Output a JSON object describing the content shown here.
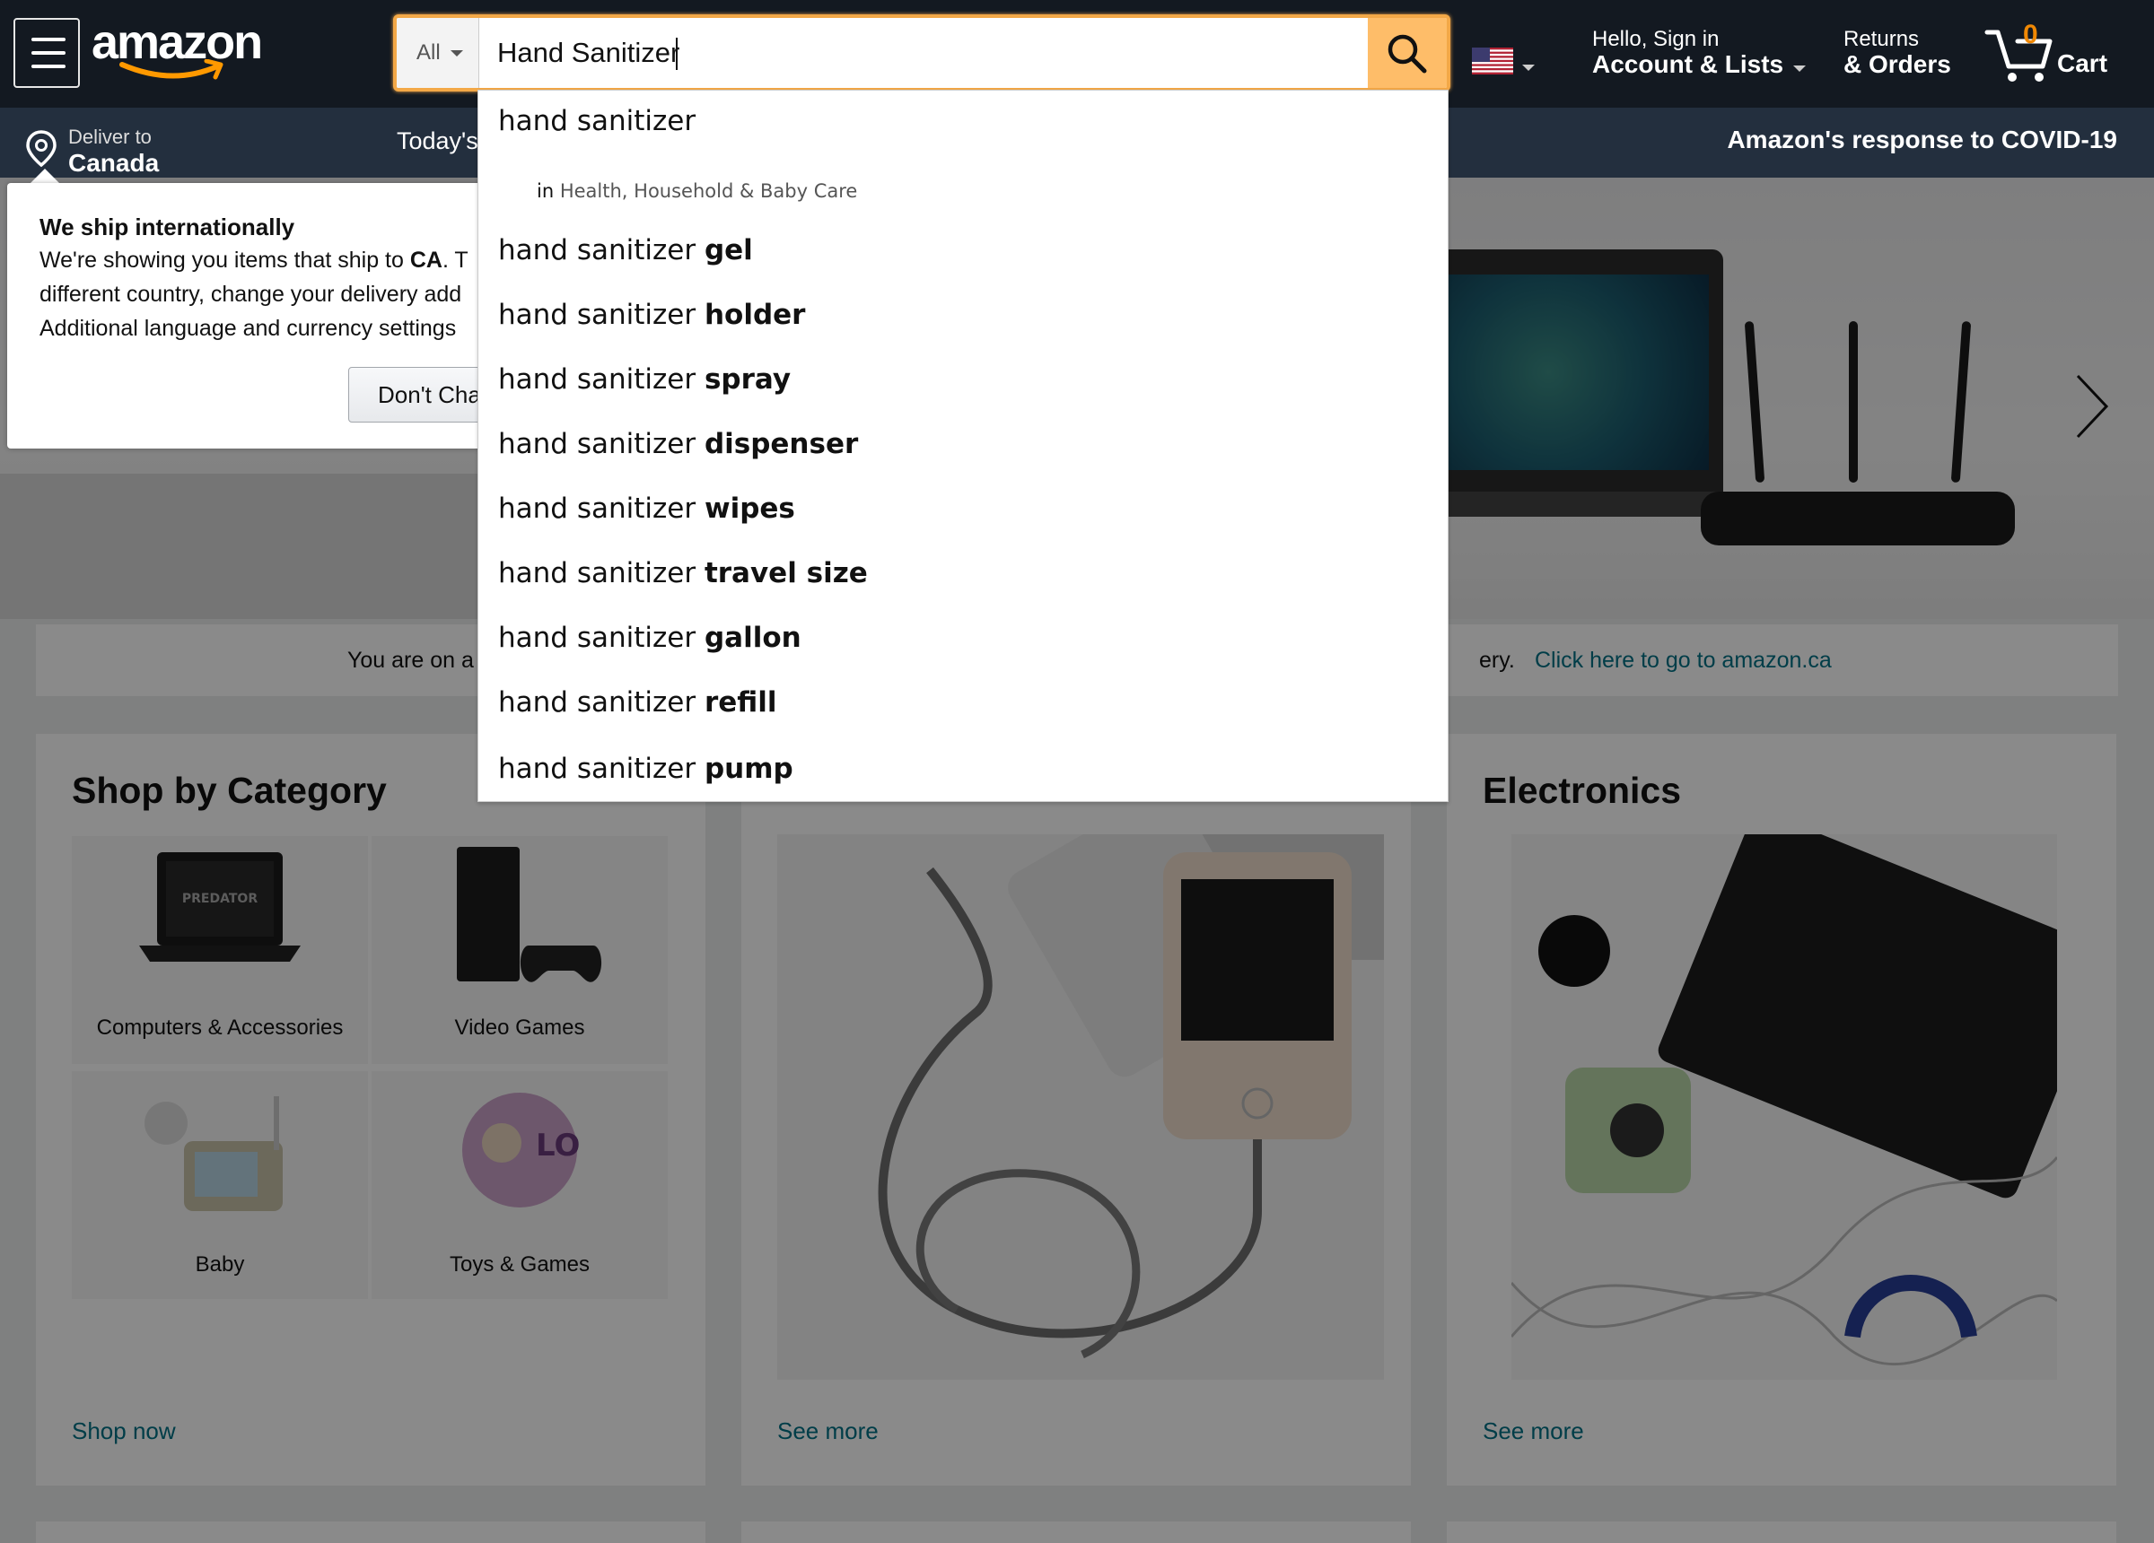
{
  "header": {
    "logo_text": "amazon",
    "search": {
      "category": "All",
      "query": "Hand Sanitizer"
    },
    "greeting": "Hello, Sign in",
    "account_label": "Account & Lists",
    "returns_line1": "Returns",
    "returns_line2": "& Orders",
    "cart_count": "0",
    "cart_label": "Cart"
  },
  "subnav": {
    "deliver_line1": "Deliver to",
    "deliver_line2": "Canada",
    "todays_deals": "Today's",
    "covid_link": "Amazon's response to COVID-19"
  },
  "popover": {
    "title": "We ship internationally",
    "line1_prefix": "We're showing you items that ship to ",
    "line1_bold": "CA",
    "line1_suffix": ". T",
    "line2": "different country, change your delivery add",
    "line3": "Additional language and currency settings",
    "button": "Don't Char"
  },
  "suggestions": {
    "first": "hand sanitizer",
    "department_prefix": "in",
    "department": "Health, Household & Baby Care",
    "items": [
      {
        "prefix": "hand sanitizer ",
        "bold": "gel"
      },
      {
        "prefix": "hand sanitizer ",
        "bold": "holder"
      },
      {
        "prefix": "hand sanitizer ",
        "bold": "spray"
      },
      {
        "prefix": "hand sanitizer ",
        "bold": "dispenser"
      },
      {
        "prefix": "hand sanitizer ",
        "bold": "wipes"
      },
      {
        "prefix": "hand sanitizer ",
        "bold": "travel size"
      },
      {
        "prefix": "hand sanitizer ",
        "bold": "gallon"
      },
      {
        "prefix": "hand sanitizer ",
        "bold": "refill"
      },
      {
        "prefix": "hand sanitizer ",
        "bold": "pump"
      }
    ]
  },
  "notice": {
    "text_start": "You are on a",
    "text_end": "ery.",
    "link": "Click here to go to amazon.ca"
  },
  "cards": {
    "shop_by_category": {
      "title": "Shop by Category",
      "tiles": [
        "Computers & Accessories",
        "Video Games",
        "Baby",
        "Toys & Games"
      ],
      "link": "Shop now"
    },
    "amazon_basics": {
      "link": "See more"
    },
    "electronics": {
      "title": "Electronics",
      "link": "See more"
    }
  },
  "colors": {
    "nav_bg": "#131921",
    "subnav_bg": "#232f3e",
    "search_button": "#febd69",
    "search_focus": "#f3a847",
    "cart_count": "#f08804",
    "link": "#007185"
  },
  "icons": {
    "menu": "hamburger-icon",
    "search": "magnifier-icon",
    "location": "location-pin-icon",
    "cart": "cart-icon",
    "flag": "us-flag-icon",
    "next": "chevron-right-icon"
  }
}
